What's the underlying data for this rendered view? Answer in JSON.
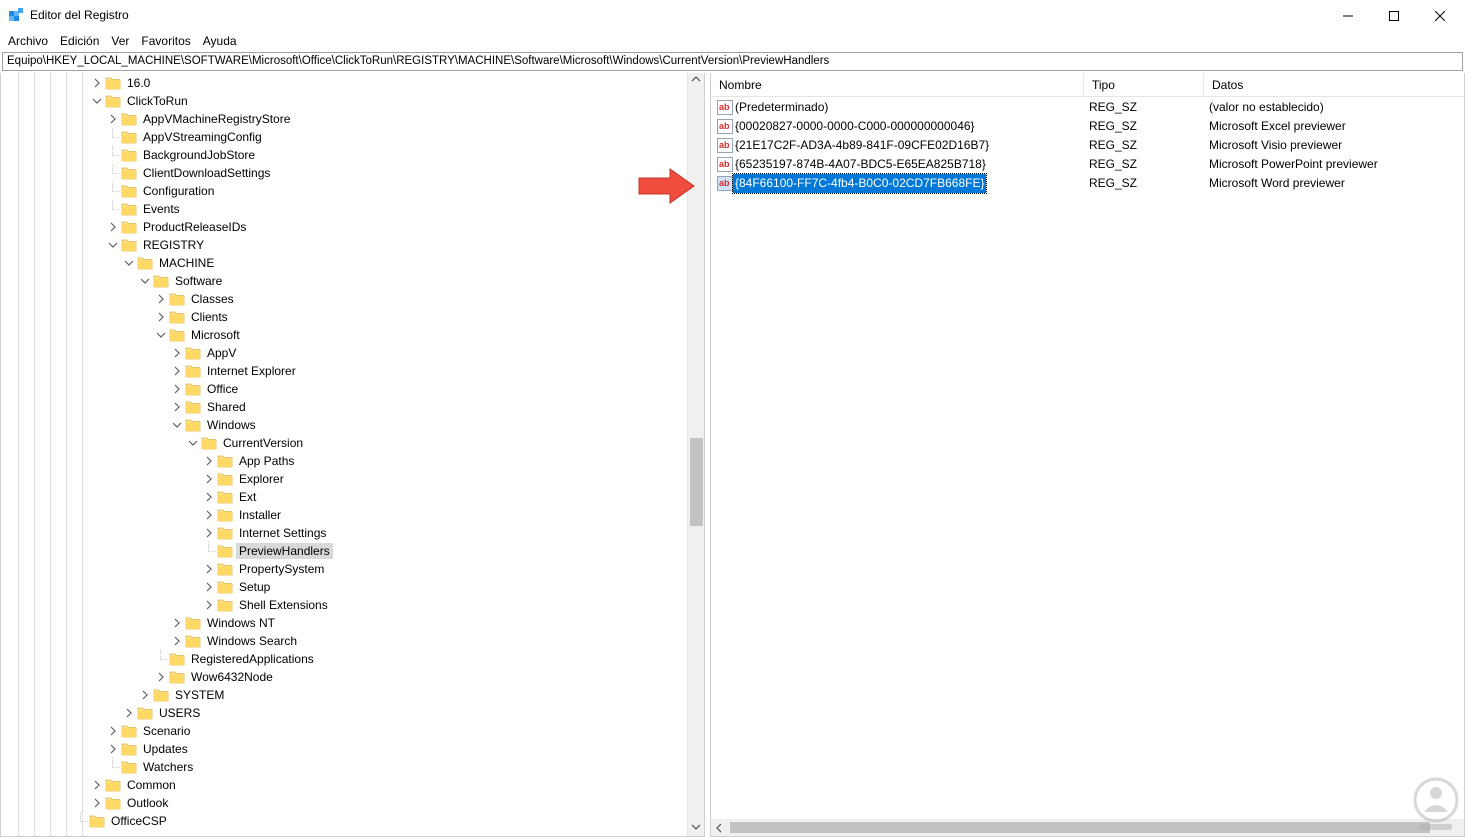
{
  "window": {
    "title": "Editor del Registro"
  },
  "menu": [
    "Archivo",
    "Edición",
    "Ver",
    "Favoritos",
    "Ayuda"
  ],
  "address": "Equipo\\HKEY_LOCAL_MACHINE\\SOFTWARE\\Microsoft\\Office\\ClickToRun\\REGISTRY\\MACHINE\\Software\\Microsoft\\Windows\\CurrentVersion\\PreviewHandlers",
  "tree": [
    {
      "label": "16.0",
      "depth": 0,
      "chevron": "right"
    },
    {
      "label": "ClickToRun",
      "depth": 0,
      "chevron": "down"
    },
    {
      "label": "AppVMachineRegistryStore",
      "depth": 1,
      "chevron": "right"
    },
    {
      "label": "AppVStreamingConfig",
      "depth": 1,
      "chevron": "none"
    },
    {
      "label": "BackgroundJobStore",
      "depth": 1,
      "chevron": "none"
    },
    {
      "label": "ClientDownloadSettings",
      "depth": 1,
      "chevron": "none"
    },
    {
      "label": "Configuration",
      "depth": 1,
      "chevron": "none"
    },
    {
      "label": "Events",
      "depth": 1,
      "chevron": "none"
    },
    {
      "label": "ProductReleaseIDs",
      "depth": 1,
      "chevron": "right"
    },
    {
      "label": "REGISTRY",
      "depth": 1,
      "chevron": "down"
    },
    {
      "label": "MACHINE",
      "depth": 2,
      "chevron": "down"
    },
    {
      "label": "Software",
      "depth": 3,
      "chevron": "down"
    },
    {
      "label": "Classes",
      "depth": 4,
      "chevron": "right"
    },
    {
      "label": "Clients",
      "depth": 4,
      "chevron": "right"
    },
    {
      "label": "Microsoft",
      "depth": 4,
      "chevron": "down"
    },
    {
      "label": "AppV",
      "depth": 5,
      "chevron": "right"
    },
    {
      "label": "Internet Explorer",
      "depth": 5,
      "chevron": "right"
    },
    {
      "label": "Office",
      "depth": 5,
      "chevron": "right"
    },
    {
      "label": "Shared",
      "depth": 5,
      "chevron": "right"
    },
    {
      "label": "Windows",
      "depth": 5,
      "chevron": "down"
    },
    {
      "label": "CurrentVersion",
      "depth": 6,
      "chevron": "down"
    },
    {
      "label": "App Paths",
      "depth": 7,
      "chevron": "right"
    },
    {
      "label": "Explorer",
      "depth": 7,
      "chevron": "right"
    },
    {
      "label": "Ext",
      "depth": 7,
      "chevron": "right"
    },
    {
      "label": "Installer",
      "depth": 7,
      "chevron": "right"
    },
    {
      "label": "Internet Settings",
      "depth": 7,
      "chevron": "right"
    },
    {
      "label": "PreviewHandlers",
      "depth": 7,
      "chevron": "none",
      "selected": true
    },
    {
      "label": "PropertySystem",
      "depth": 7,
      "chevron": "right"
    },
    {
      "label": "Setup",
      "depth": 7,
      "chevron": "right"
    },
    {
      "label": "Shell Extensions",
      "depth": 7,
      "chevron": "right"
    },
    {
      "label": "Windows NT",
      "depth": 5,
      "chevron": "right"
    },
    {
      "label": "Windows Search",
      "depth": 5,
      "chevron": "right"
    },
    {
      "label": "RegisteredApplications",
      "depth": 4,
      "chevron": "none"
    },
    {
      "label": "Wow6432Node",
      "depth": 4,
      "chevron": "right"
    },
    {
      "label": "SYSTEM",
      "depth": 3,
      "chevron": "right"
    },
    {
      "label": "USERS",
      "depth": 2,
      "chevron": "right"
    },
    {
      "label": "Scenario",
      "depth": 1,
      "chevron": "right"
    },
    {
      "label": "Updates",
      "depth": 1,
      "chevron": "right"
    },
    {
      "label": "Watchers",
      "depth": 1,
      "chevron": "none"
    },
    {
      "label": "Common",
      "depth": 0,
      "chevron": "right"
    },
    {
      "label": "Outlook",
      "depth": 0,
      "chevron": "right"
    },
    {
      "label": "OfficeCSP",
      "depth": -1,
      "chevron": "none"
    }
  ],
  "list": {
    "columns": {
      "name": "Nombre",
      "type": "Tipo",
      "data": "Datos"
    },
    "rows": [
      {
        "name": "(Predeterminado)",
        "type": "REG_SZ",
        "data": "(valor no establecido)"
      },
      {
        "name": "{00020827-0000-0000-C000-000000000046}",
        "type": "REG_SZ",
        "data": "Microsoft Excel previewer"
      },
      {
        "name": "{21E17C2F-AD3A-4b89-841F-09CFE02D16B7}",
        "type": "REG_SZ",
        "data": "Microsoft Visio previewer"
      },
      {
        "name": "{65235197-874B-4A07-BDC5-E65EA825B718}",
        "type": "REG_SZ",
        "data": "Microsoft PowerPoint previewer"
      },
      {
        "name": "{84F66100-FF7C-4fb4-B0C0-02CD7FB668FE}",
        "type": "REG_SZ",
        "data": "Microsoft Word previewer",
        "selected": true
      }
    ]
  },
  "colors": {
    "selection": "#0078d7",
    "tree_selection": "#d9d9d9",
    "folder": "#ffe08a",
    "arrow": "#f04b3c"
  }
}
